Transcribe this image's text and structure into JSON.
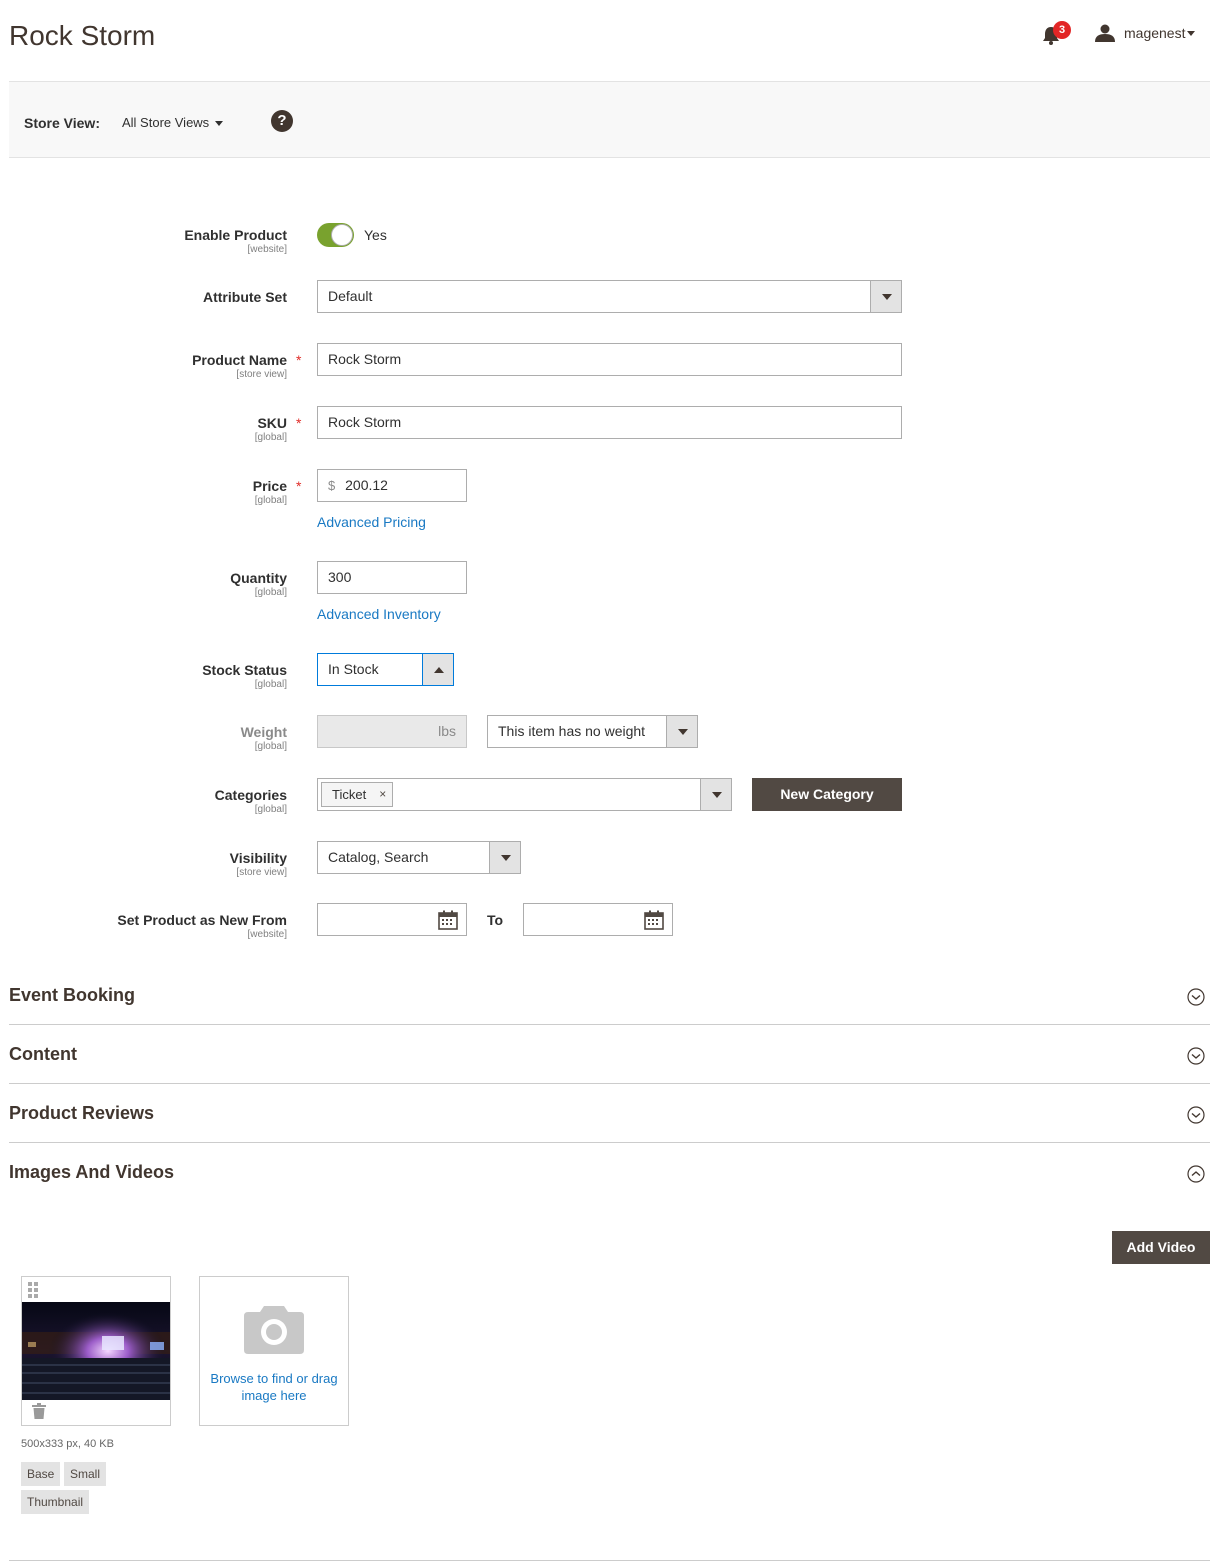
{
  "page": {
    "title": "Rock Storm"
  },
  "header": {
    "notifications_count": "3",
    "user_name": "magenest"
  },
  "store_view": {
    "label": "Store View:",
    "value": "All Store Views",
    "help": "?"
  },
  "form": {
    "enable_product": {
      "label": "Enable Product",
      "scope": "[website]",
      "value": "Yes",
      "enabled": true
    },
    "attribute_set": {
      "label": "Attribute Set",
      "value": "Default"
    },
    "product_name": {
      "label": "Product Name",
      "scope": "[store view]",
      "value": "Rock Storm",
      "required": "*"
    },
    "sku": {
      "label": "SKU",
      "scope": "[global]",
      "value": "Rock Storm",
      "required": "*"
    },
    "price": {
      "label": "Price",
      "scope": "[global]",
      "currency": "$",
      "value": "200.12",
      "required": "*",
      "link": "Advanced Pricing"
    },
    "quantity": {
      "label": "Quantity",
      "scope": "[global]",
      "value": "300",
      "link": "Advanced Inventory"
    },
    "stock_status": {
      "label": "Stock Status",
      "scope": "[global]",
      "value": "In Stock"
    },
    "weight": {
      "label": "Weight",
      "scope": "[global]",
      "unit": "lbs",
      "option": "This item has no weight"
    },
    "categories": {
      "label": "Categories",
      "scope": "[global]",
      "tags": [
        "Ticket"
      ],
      "remove": "×",
      "new_button": "New Category"
    },
    "visibility": {
      "label": "Visibility",
      "scope": "[store view]",
      "value": "Catalog, Search"
    },
    "new_from": {
      "label": "Set Product as New From",
      "scope": "[website]",
      "to_label": "To"
    }
  },
  "sections": [
    {
      "title": "Event Booking",
      "expanded": false
    },
    {
      "title": "Content",
      "expanded": false
    },
    {
      "title": "Product Reviews",
      "expanded": false
    },
    {
      "title": "Images And Videos",
      "expanded": true
    }
  ],
  "images": {
    "add_video": "Add Video",
    "upload_text": "Browse to find or drag image here",
    "image_info": "500x333 px, 40 KB",
    "roles": [
      "Base",
      "Small",
      "Thumbnail"
    ]
  },
  "colors": {
    "accent": "#eb5202",
    "link": "#1979c3",
    "toggle_on": "#79a22e",
    "dark_button": "#514943",
    "badge": "#e22626"
  }
}
